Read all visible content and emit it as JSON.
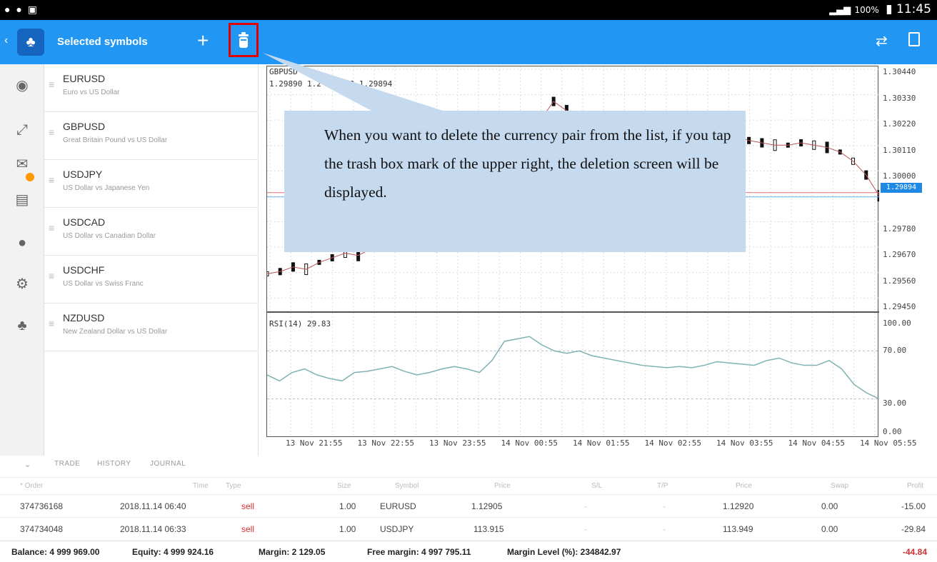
{
  "status_bar": {
    "left_icons": "● ● ▣",
    "signal": "📶",
    "battery": "100%",
    "time": "11:45"
  },
  "app_bar": {
    "title": "Selected symbols",
    "add_label": "+"
  },
  "symbols": [
    {
      "name": "EURUSD",
      "description": "Euro vs US Dollar"
    },
    {
      "name": "GBPUSD",
      "description": "Great Britain Pound vs US Dollar"
    },
    {
      "name": "USDJPY",
      "description": "US Dollar vs Japanese Yen"
    },
    {
      "name": "USDCAD",
      "description": "US Dollar vs Canadian Dollar"
    },
    {
      "name": "USDCHF",
      "description": "US Dollar vs Swiss Franc"
    },
    {
      "name": "NZDUSD",
      "description": "New Zealand Dollar vs US Dollar"
    }
  ],
  "chart": {
    "symbol": "GBPUSD",
    "ohlc": "1.29890 1.2   ...   00 1.29894",
    "rsi_label": "RSI(14) 29.83",
    "current_price": "1.29894"
  },
  "chart_data": {
    "type": "line",
    "x_labels": [
      "13 Nov 21:55",
      "13 Nov 22:55",
      "13 Nov 23:55",
      "14 Nov 00:55",
      "14 Nov 01:55",
      "14 Nov 02:55",
      "14 Nov 03:55",
      "14 Nov 04:55",
      "14 Nov 05:55"
    ],
    "price_ticks": [
      "1.30440",
      "1.30330",
      "1.30220",
      "1.30110",
      "1.30000",
      "1.29780",
      "1.29670",
      "1.29560",
      "1.29450"
    ],
    "rsi_ticks": [
      "100.00",
      "70.00",
      "30.00",
      "0.00"
    ],
    "price_ylim": [
      1.2939,
      1.3044
    ],
    "rsi_ylim": [
      0,
      100
    ],
    "series": [
      {
        "values": [
          1.2955,
          1.2956,
          1.2958,
          1.2957,
          1.296,
          1.2962,
          1.2964,
          1.2963,
          1.2966,
          1.2968,
          1.2967,
          1.2969,
          1.2968,
          1.2966,
          1.2968,
          1.2967,
          1.2969,
          1.2971,
          1.298,
          1.2994,
          1.3008,
          1.3022,
          1.303,
          1.3026,
          1.3022,
          1.3018,
          1.3016,
          1.3015,
          1.3014,
          1.3013,
          1.3013,
          1.3012,
          1.3012,
          1.3013,
          1.3014,
          1.3013,
          1.3015,
          1.3013,
          1.3012,
          1.3011,
          1.3011,
          1.3012,
          1.3011,
          1.301,
          1.3008,
          1.3004,
          1.2998,
          1.2989
        ]
      },
      {
        "values": [
          50,
          45,
          52,
          55,
          50,
          47,
          45,
          52,
          53,
          55,
          57,
          53,
          50,
          52,
          55,
          57,
          55,
          52,
          62,
          78,
          80,
          82,
          75,
          70,
          68,
          70,
          66,
          64,
          62,
          60,
          58,
          57,
          56,
          57,
          56,
          58,
          61,
          60,
          59,
          58,
          62,
          64,
          60,
          58,
          58,
          62,
          55,
          42,
          35,
          30
        ]
      }
    ]
  },
  "trade_tabs": {
    "collapse": "⌄",
    "trade": "TRADE",
    "history": "HISTORY",
    "journal": "JOURNAL"
  },
  "table_headers": {
    "order": "* Order",
    "time": "Time",
    "type": "Type",
    "size": "Size",
    "symbol": "Symbol",
    "price": "Price",
    "sl": "S/L",
    "tp": "T/P",
    "cur_price": "Price",
    "swap": "Swap",
    "profit": "Profit"
  },
  "trades": [
    {
      "order": "374736168",
      "time": "2018.11.14 06:40",
      "type": "sell",
      "size": "1.00",
      "symbol": "EURUSD",
      "price": "1.12905",
      "sl": "-",
      "tp": "-",
      "cur_price": "1.12920",
      "swap": "0.00",
      "profit": "-15.00"
    },
    {
      "order": "374734048",
      "time": "2018.11.14 06:33",
      "type": "sell",
      "size": "1.00",
      "symbol": "USDJPY",
      "price": "113.915",
      "sl": "-",
      "tp": "-",
      "cur_price": "113.949",
      "swap": "0.00",
      "profit": "-29.84"
    }
  ],
  "summary": {
    "balance": "Balance: 4 999 969.00",
    "equity": "Equity: 4 999 924.16",
    "margin": "Margin: 2 129.05",
    "free_margin": "Free margin: 4 997 795.11",
    "margin_level": "Margin Level (%): 234842.97",
    "total": "-44.84"
  },
  "callout": {
    "text": "When you want to delete the currency pair from the list, if you tap the trash box mark of the upper right, the deletion screen will be displayed."
  },
  "colors": {
    "appbar": "#2196f3",
    "callout": "#c5d9ef",
    "highlight": "#e10000",
    "sell": "#d32f2f"
  }
}
